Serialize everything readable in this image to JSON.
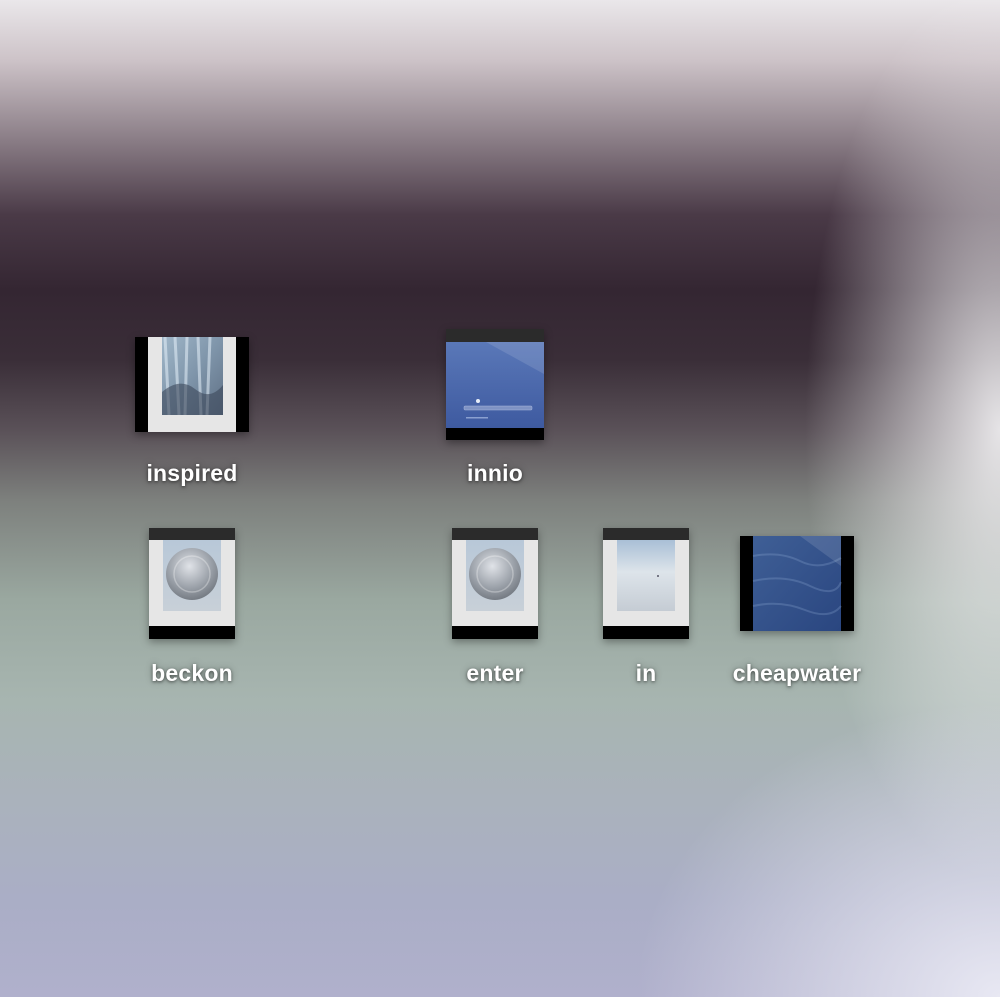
{
  "desktop": {
    "icons": [
      {
        "id": "inspired",
        "label": "inspired",
        "type": "waterfall-photo-icon"
      },
      {
        "id": "innio",
        "label": "innio",
        "type": "login-screen-icon"
      },
      {
        "id": "beckon",
        "label": "beckon",
        "type": "orb-photo-icon"
      },
      {
        "id": "enter",
        "label": "enter",
        "type": "orb-photo-icon"
      },
      {
        "id": "in",
        "label": "in",
        "type": "snowfield-photo-icon"
      },
      {
        "id": "cheapwater",
        "label": "cheapwater",
        "type": "ocean-photo-icon"
      }
    ]
  }
}
